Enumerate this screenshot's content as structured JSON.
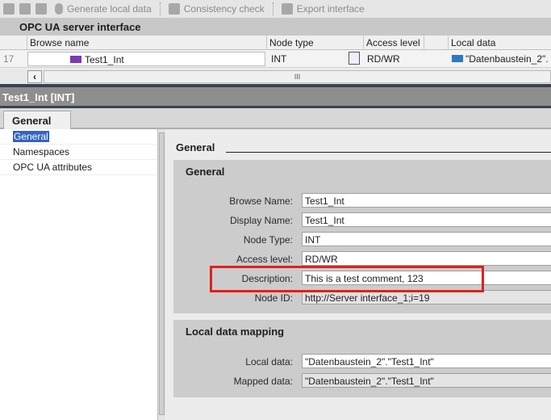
{
  "toolbar": {
    "generate": "Generate local data",
    "consistency": "Consistency check",
    "export": "Export interface"
  },
  "panel_title": "OPC UA server interface",
  "table": {
    "headers": [
      "Browse name",
      "Node type",
      "Access level",
      "Local data"
    ],
    "row": {
      "index": "17",
      "browse_name": "Test1_Int",
      "node_type": "INT",
      "access_level": "RD/WR",
      "local_data": "\"Datenbaustein_2\"."
    }
  },
  "scroll_grip": "III",
  "inspector_title": "Test1_Int [INT]",
  "tab": "General",
  "nav": [
    "General",
    "Namespaces",
    "OPC UA attributes"
  ],
  "section_title": "General",
  "general": {
    "title": "General",
    "fields": [
      {
        "label": "Browse Name:",
        "value": "Test1_Int"
      },
      {
        "label": "Display Name:",
        "value": "Test1_Int"
      },
      {
        "label": "Node Type:",
        "value": "INT"
      },
      {
        "label": "Access level:",
        "value": "RD/WR"
      },
      {
        "label": "Description:",
        "value": "This is a test comment, 123"
      },
      {
        "label": "Node ID:",
        "value": "http://Server interface_1;i=19"
      }
    ]
  },
  "mapping": {
    "title": "Local data mapping",
    "fields": [
      {
        "label": "Local data:",
        "value": "\"Datenbaustein_2\".\"Test1_Int\""
      },
      {
        "label": "Mapped data:",
        "value": "\"Datenbaustein_2\".\"Test1_Int\""
      }
    ]
  },
  "highlight_color": "#e02020"
}
